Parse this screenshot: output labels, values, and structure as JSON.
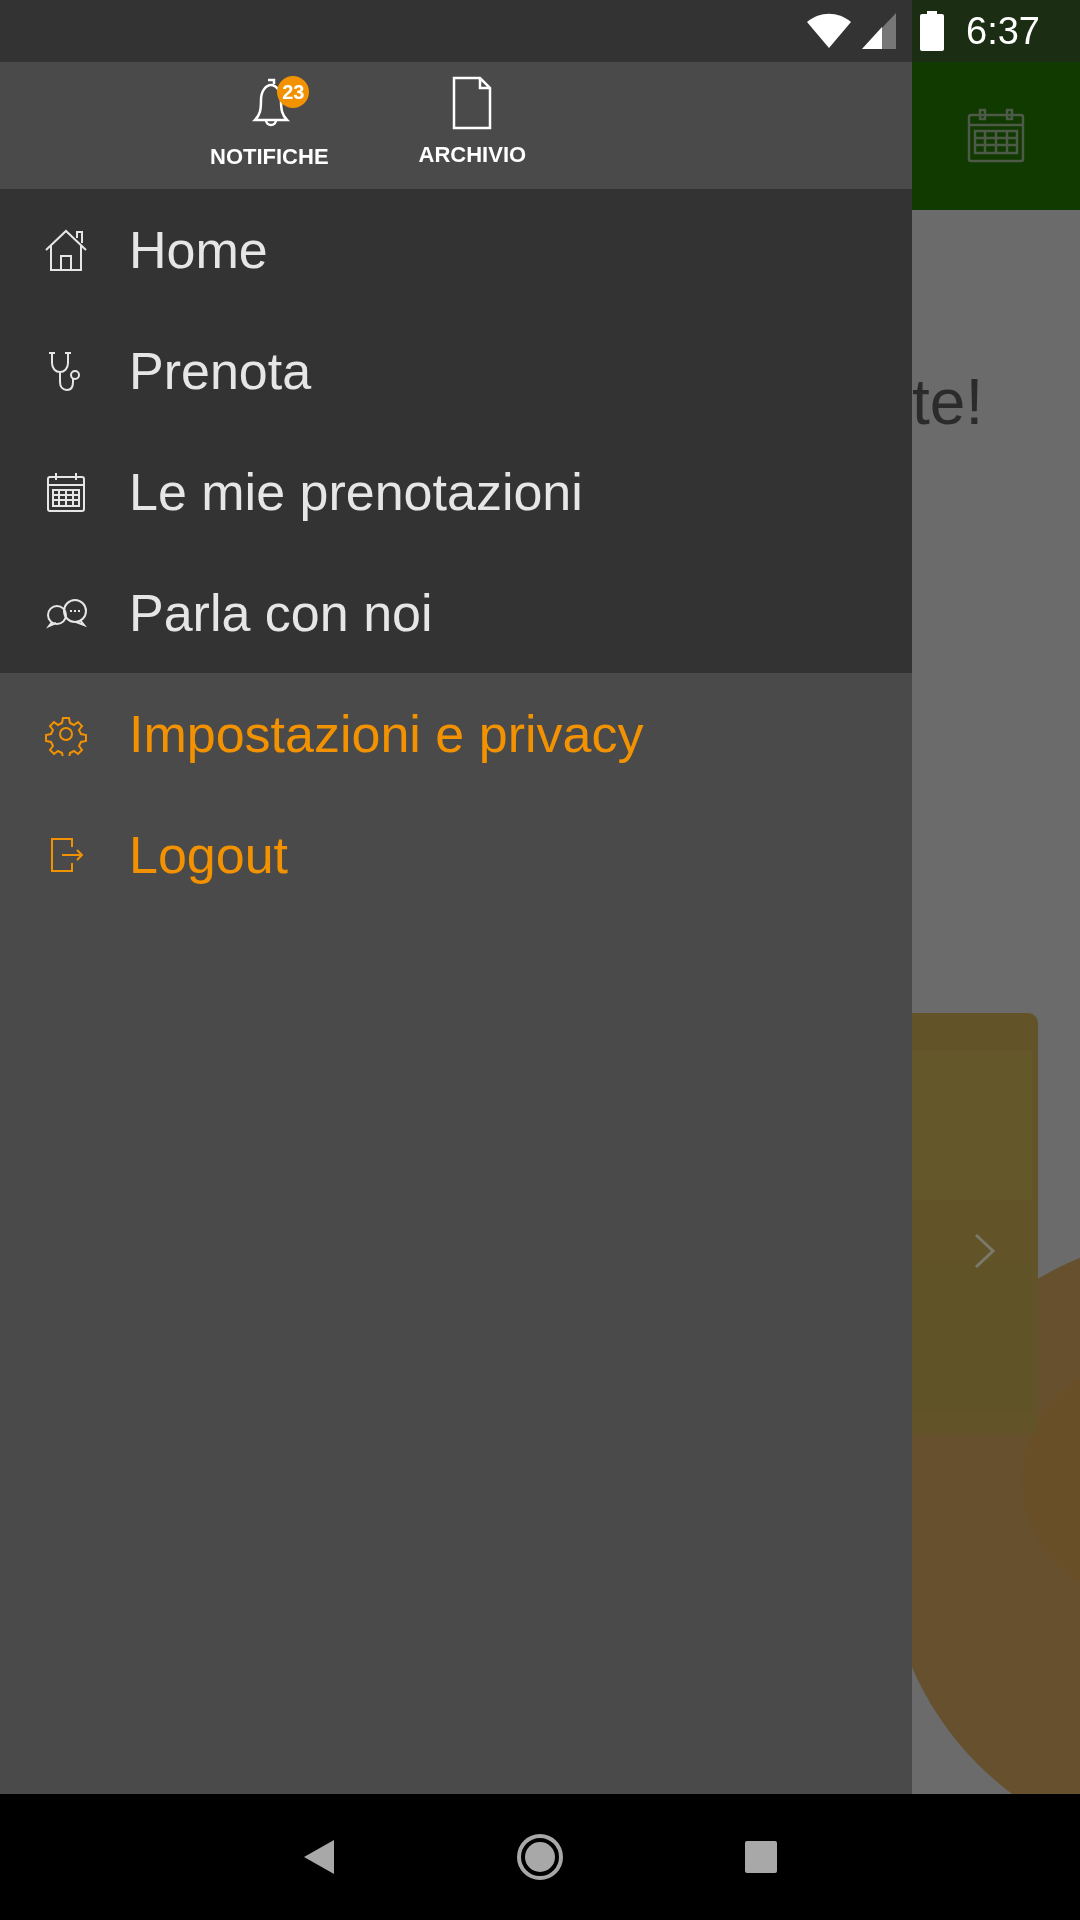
{
  "status_bar": {
    "time": "6:37"
  },
  "drawer_header": [
    {
      "kind": "bell",
      "label": "NOTIFICHE",
      "badge": "23"
    },
    {
      "kind": "document",
      "label": "ARCHIVIO"
    }
  ],
  "menu": [
    {
      "kind": "home",
      "label": "Home"
    },
    {
      "kind": "stethoscope",
      "label": "Prenota"
    },
    {
      "kind": "calendar",
      "label": "Le mie prenotazioni"
    },
    {
      "kind": "chat",
      "label": "Parla con noi"
    }
  ],
  "account_menu": [
    {
      "kind": "gear",
      "label": "Impostazioni e privacy"
    },
    {
      "kind": "logout",
      "label": "Logout"
    }
  ],
  "background": {
    "heading_fragment": "te!"
  }
}
